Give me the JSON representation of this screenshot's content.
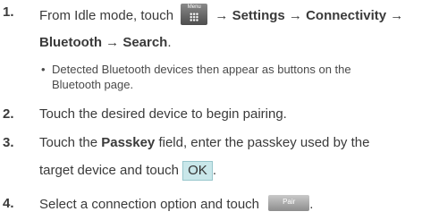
{
  "steps": [
    {
      "number": "1.",
      "line1_pre": "From Idle mode, touch",
      "menu_icon_label": "Menu",
      "line1_post": "→ Settings → Connectivity →",
      "line2": "Bluetooth → Search",
      "line2_end": ".",
      "bullet_symbol": "•",
      "bullet_line1": "Detected Bluetooth devices then appear as buttons on the",
      "bullet_line2": "Bluetooth page."
    },
    {
      "number": "2.",
      "text": "Touch the desired device to begin pairing."
    },
    {
      "number": "3.",
      "line1_pre": "Touch the",
      "line1_bold": "Passkey",
      "line1_post": "field, enter the passkey used by the",
      "line2_pre": "target device and touch",
      "ok_label": "OK",
      "line2_end": "."
    },
    {
      "number": "4.",
      "text": "Select a connection option and touch",
      "pair_label": "Pair",
      "end": "."
    }
  ]
}
